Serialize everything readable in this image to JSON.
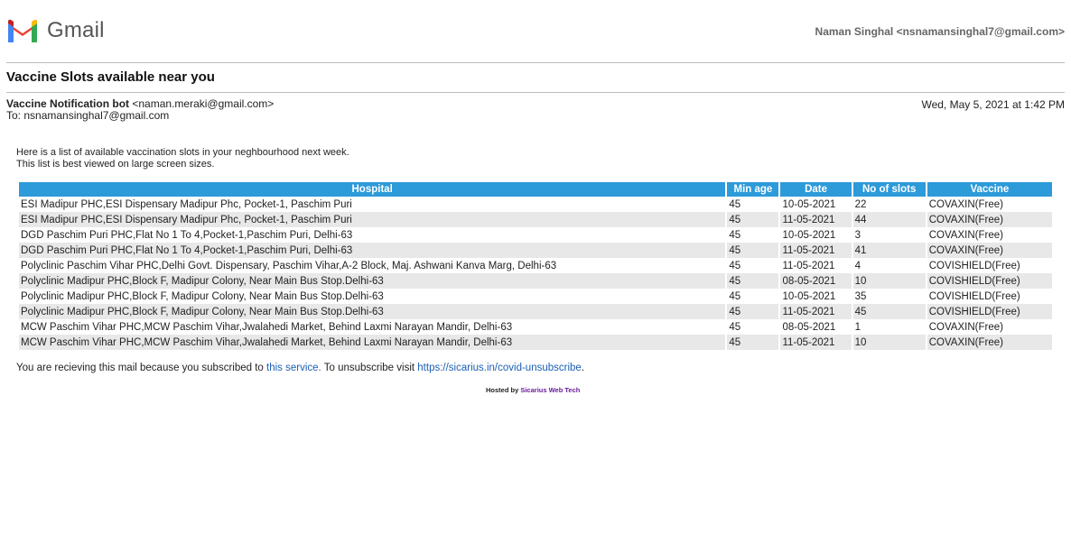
{
  "header": {
    "app_name": "Gmail",
    "account": "Naman Singhal <nsnamansinghal7@gmail.com>",
    "logo_colors": [
      "#4285F4",
      "#EA4335",
      "#FBBC04",
      "#34A853",
      "#C5221F"
    ]
  },
  "email": {
    "subject": "Vaccine Slots available near you",
    "from_name": "Vaccine Notification bot",
    "from_address": "<naman.meraki@gmail.com>",
    "to": "To: nsnamansinghal7@gmail.com",
    "date": "Wed, May 5, 2021 at 1:42 PM"
  },
  "body": {
    "intro_line1": "Here is a list of available vaccination slots in your neghbourhood next week.",
    "intro_line2": "This list is best viewed on large screen sizes.",
    "table": {
      "columns": [
        "Hospital",
        "Min age",
        "Date",
        "No of slots",
        "Vaccine"
      ],
      "header_color": "#2d9ad9",
      "rows": [
        [
          "ESI Madipur PHC,ESI Dispensary Madipur Phc, Pocket-1, Paschim Puri",
          "45",
          "10-05-2021",
          "22",
          "COVAXIN(Free)"
        ],
        [
          "ESI Madipur PHC,ESI Dispensary Madipur Phc, Pocket-1, Paschim Puri",
          "45",
          "11-05-2021",
          "44",
          "COVAXIN(Free)"
        ],
        [
          "DGD Paschim Puri PHC,Flat No 1 To 4,Pocket-1,Paschim Puri, Delhi-63",
          "45",
          "10-05-2021",
          "3",
          "COVAXIN(Free)"
        ],
        [
          "DGD Paschim Puri PHC,Flat No 1 To 4,Pocket-1,Paschim Puri, Delhi-63",
          "45",
          "11-05-2021",
          "41",
          "COVAXIN(Free)"
        ],
        [
          "Polyclinic Paschim Vihar PHC,Delhi Govt. Dispensary, Paschim Vihar,A-2 Block, Maj. Ashwani Kanva Marg, Delhi-63",
          "45",
          "11-05-2021",
          "4",
          "COVISHIELD(Free)"
        ],
        [
          "Polyclinic Madipur PHC,Block F, Madipur Colony, Near Main Bus Stop.Delhi-63",
          "45",
          "08-05-2021",
          "10",
          "COVISHIELD(Free)"
        ],
        [
          "Polyclinic Madipur PHC,Block F, Madipur Colony, Near Main Bus Stop.Delhi-63",
          "45",
          "10-05-2021",
          "35",
          "COVISHIELD(Free)"
        ],
        [
          "Polyclinic Madipur PHC,Block F, Madipur Colony, Near Main Bus Stop.Delhi-63",
          "45",
          "11-05-2021",
          "45",
          "COVISHIELD(Free)"
        ],
        [
          "MCW Paschim Vihar PHC,MCW Paschim Vihar,Jwalahedi Market, Behind Laxmi Narayan Mandir, Delhi-63",
          "45",
          "08-05-2021",
          "1",
          "COVAXIN(Free)"
        ],
        [
          "MCW Paschim Vihar PHC,MCW Paschim Vihar,Jwalahedi Market, Behind Laxmi Narayan Mandir, Delhi-63",
          "45",
          "11-05-2021",
          "10",
          "COVAXIN(Free)"
        ]
      ]
    },
    "footer_prefix": "You are recieving this mail because you subscribed to ",
    "footer_link1": "this service.",
    "footer_middle": " To unsubscribe visit ",
    "footer_link2": "https://sicarius.in/covid-unsubscribe",
    "footer_suffix": ".",
    "hosted_prefix": "Hosted by ",
    "hosted_link": "Sicarius Web Tech"
  }
}
